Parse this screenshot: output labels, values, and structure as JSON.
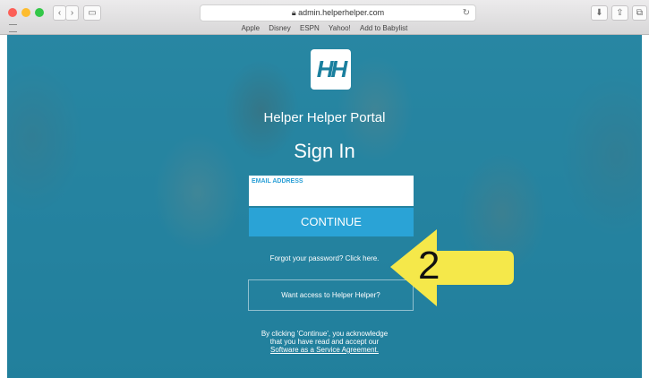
{
  "browser": {
    "url": "admin.helperhelper.com",
    "bookmarks": [
      "Apple",
      "Disney",
      "ESPN",
      "Yahoo!",
      "Add to Babylist"
    ]
  },
  "page": {
    "logo_text": "HH",
    "portal_title": "Helper Helper Portal",
    "heading": "Sign In",
    "email_label": "EMAIL ADDRESS",
    "email_value": "",
    "continue_label": "CONTINUE",
    "forgot_text": "Forgot your password? Click here.",
    "access_text": "Want access to Helper Helper?",
    "legal_line1": "By clicking 'Continue', you acknowledge",
    "legal_line2": "that you have read and accept our",
    "legal_link": "Software as a Service Agreement."
  },
  "annotation": {
    "step_number": "2",
    "arrow_color": "#f5e84a"
  }
}
